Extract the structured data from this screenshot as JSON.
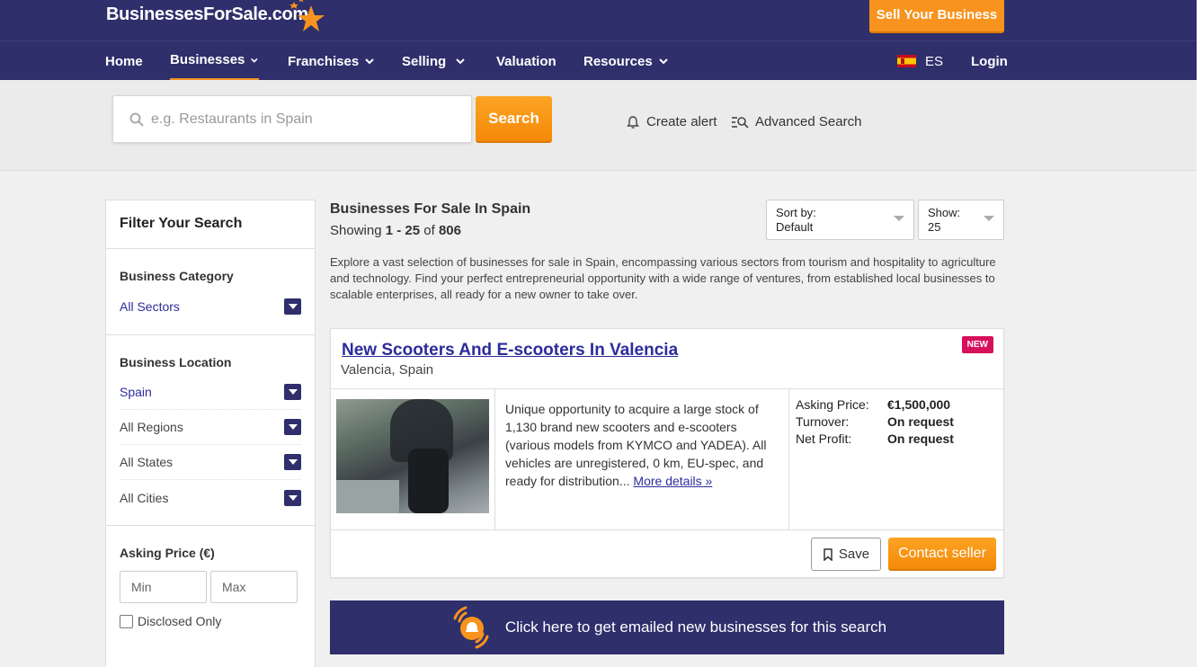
{
  "header": {
    "logo_text": "BusinessesForSale.com",
    "sell_button": "Sell Your Business",
    "accent": "#f7931e",
    "brand": "#2e2f6b"
  },
  "nav": {
    "items": [
      {
        "label": "Home"
      },
      {
        "label": "Businesses"
      },
      {
        "label": "Franchises"
      },
      {
        "label": "Selling"
      },
      {
        "label": "Valuation"
      },
      {
        "label": "Resources"
      }
    ],
    "language": "ES",
    "login": "Login"
  },
  "search": {
    "placeholder": "e.g. Restaurants in Spain",
    "button": "Search",
    "create_alert": "Create alert",
    "advanced": "Advanced Search"
  },
  "filters": {
    "title": "Filter Your Search",
    "category": {
      "heading": "Business Category",
      "value": "All Sectors"
    },
    "location": {
      "heading": "Business Location",
      "country": "Spain",
      "regions": "All Regions",
      "states": "All States",
      "cities": "All Cities"
    },
    "price": {
      "heading": "Asking Price (€)",
      "min_placeholder": "Min",
      "max_placeholder": "Max",
      "disclosed": "Disclosed Only"
    }
  },
  "results": {
    "title": "Businesses For Sale In Spain",
    "showing_prefix": "Showing",
    "range": "1 - 25",
    "of": "of",
    "total": "806",
    "sort_label": "Sort by:",
    "sort_value": "Default",
    "show_label": "Show:",
    "show_value": "25",
    "description": "Explore a vast selection of businesses for sale in Spain, encompassing various sectors from tourism and hospitality to agriculture and technology. Find your perfect entrepreneurial opportunity with a wide range of ventures, from established local businesses to scalable enterprises, all ready for a new owner to take over."
  },
  "listing": {
    "title": "New Scooters And E-scooters In Valencia",
    "location": "Valencia, Spain",
    "badge": "NEW",
    "summary": "Unique opportunity to acquire a large stock of 1,130 brand new scooters and e-scooters (various models from KYMCO and YADEA). All vehicles are unregistered, 0 km, EU-spec, and ready for distribution...",
    "more": "More details »",
    "asking_label": "Asking Price:",
    "asking_value": "€1,500,000",
    "turnover_label": "Turnover:",
    "turnover_value": "On request",
    "profit_label": "Net Profit:",
    "profit_value": "On request",
    "save": "Save",
    "contact": "Contact seller"
  },
  "banner": {
    "text": "Click here to get emailed new businesses for this search"
  }
}
